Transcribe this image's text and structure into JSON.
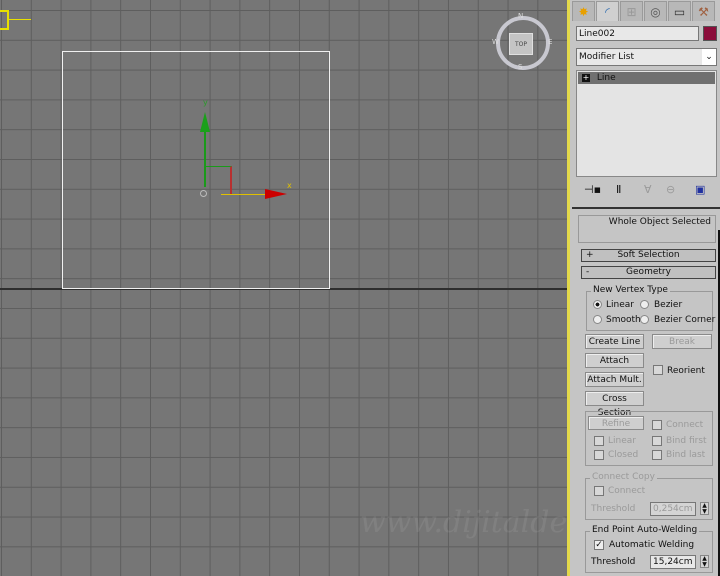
{
  "viewport": {
    "label_y": "y",
    "label_x": "x",
    "viewcube_face": "TOP",
    "compass": {
      "n": "N",
      "s": "S",
      "e": "E",
      "w": "W"
    },
    "watermark": "www.dijitalde"
  },
  "panel": {
    "tabs": [
      {
        "icon": "create-icon"
      },
      {
        "icon": "modify-icon"
      },
      {
        "icon": "hierarchy-icon"
      },
      {
        "icon": "motion-icon"
      },
      {
        "icon": "display-icon"
      },
      {
        "icon": "utilities-icon"
      }
    ],
    "object_name": "Line002",
    "object_color": "#8b0d3a",
    "modifier_list": "Modifier List",
    "stack": [
      {
        "label": "Line",
        "expand": "+"
      }
    ],
    "selection_info": "Whole Object Selected",
    "soft_selection": {
      "sign": "+",
      "label": "Soft Selection"
    },
    "geometry": {
      "sign": "-",
      "label": "Geometry",
      "new_vertex_type": "New Vertex Type",
      "linear": "Linear",
      "bezier": "Bezier",
      "smooth": "Smooth",
      "bezier_corner": "Bezier Corner",
      "selected": "Linear",
      "create_line": "Create Line",
      "break": "Break",
      "attach": "Attach",
      "reorient": "Reorient",
      "attach_mult": "Attach Mult.",
      "cross_section": "Cross Section",
      "refine": "Refine",
      "connect": "Connect",
      "linear_cb": "Linear",
      "bind_first": "Bind first",
      "closed": "Closed",
      "bind_last": "Bind last",
      "connect_copy": "Connect Copy",
      "cc_connect": "Connect",
      "threshold": "Threshold",
      "cc_threshold": "0,254cm",
      "end_point": "End Point Auto-Welding",
      "automatic_welding": "Automatic Welding",
      "automatic_welding_checked": true,
      "ep_threshold_label": "Threshold",
      "ep_threshold": "15,24cm"
    }
  }
}
